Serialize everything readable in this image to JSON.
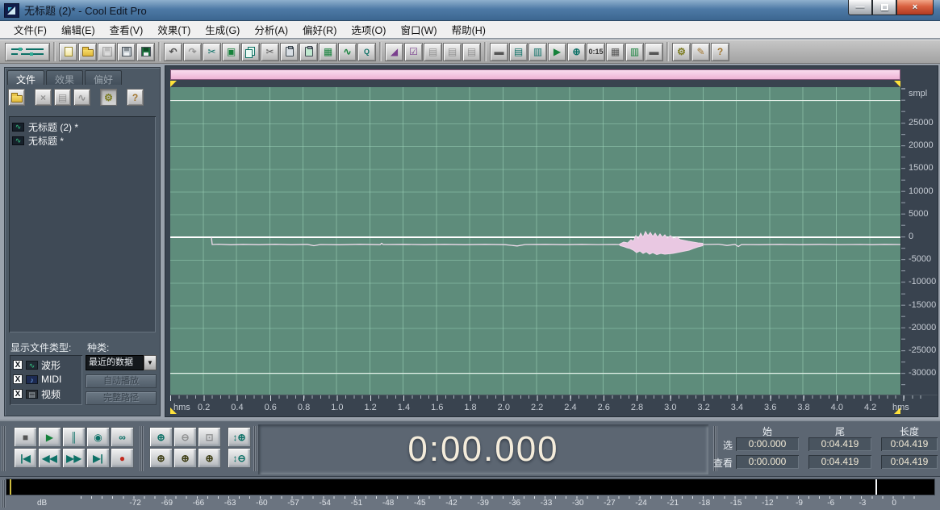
{
  "window": {
    "title": "无标题 (2)* - Cool Edit Pro"
  },
  "titlebar": {
    "minimize": "—",
    "close": "×"
  },
  "menu": {
    "items": [
      "文件(F)",
      "编辑(E)",
      "查看(V)",
      "效果(T)",
      "生成(G)",
      "分析(A)",
      "偏好(R)",
      "选项(O)",
      "窗口(W)",
      "帮助(H)"
    ]
  },
  "toolbar": {
    "groups": {
      "file": [
        {
          "name": "new-file-icon",
          "glyph": "",
          "cls": "page"
        },
        {
          "name": "open-file-icon",
          "glyph": "",
          "cls": "folder"
        },
        {
          "name": "save-file-icon",
          "glyph": "",
          "cls": "disk disabled"
        },
        {
          "name": "save-as-icon",
          "glyph": "",
          "cls": "disk"
        },
        {
          "name": "save-copy-icon",
          "glyph": "",
          "cls": "diskg"
        }
      ],
      "edit": [
        {
          "name": "undo-icon",
          "glyph": "↶",
          "cls": "gray bold"
        },
        {
          "name": "redo-icon",
          "glyph": "↷",
          "cls": "disabled bold"
        },
        {
          "name": "cut-tool-icon",
          "glyph": "✂",
          "cls": "teal"
        },
        {
          "name": "trim-icon",
          "glyph": "▣",
          "cls": "green"
        },
        {
          "name": "copy-icon",
          "glyph": "",
          "cls": "copyic"
        },
        {
          "name": "cut-icon",
          "glyph": "✂",
          "cls": "gray"
        },
        {
          "name": "paste-icon",
          "glyph": "",
          "cls": "clipic"
        },
        {
          "name": "paste-new-icon",
          "glyph": "",
          "cls": "clipic greenclip"
        },
        {
          "name": "convert-sample-type-icon",
          "glyph": "▦",
          "cls": "green"
        },
        {
          "name": "insert-multitrack-icon",
          "glyph": "∿",
          "cls": "green bold"
        },
        {
          "name": "scrub-icon",
          "glyph": "Q",
          "cls": "teal smalltext"
        }
      ],
      "view": [
        {
          "name": "envelope-tool-icon",
          "glyph": "◢",
          "cls": "purple"
        },
        {
          "name": "settings-dialog-icon",
          "glyph": "☑",
          "cls": "purple"
        },
        {
          "name": "cue-range-1-icon",
          "glyph": "▤",
          "cls": "disabled"
        },
        {
          "name": "cue-range-2-icon",
          "glyph": "▤",
          "cls": "disabled"
        },
        {
          "name": "cue-range-3-icon",
          "glyph": "▤",
          "cls": "disabled"
        }
      ],
      "windows": [
        {
          "name": "window-icon",
          "glyph": "▬",
          "cls": "gray"
        },
        {
          "name": "file-info-window-icon",
          "glyph": "▤",
          "cls": "teal"
        },
        {
          "name": "cue-list-window-icon",
          "glyph": "▥",
          "cls": "teal"
        },
        {
          "name": "play-list-window-icon",
          "glyph": "▶",
          "cls": "green"
        },
        {
          "name": "zoom-window-icon",
          "glyph": "⊕",
          "cls": "teal bold"
        },
        {
          "name": "time-window-icon",
          "glyph": "0:15",
          "cls": "smalltext"
        },
        {
          "name": "cue-sheet-icon",
          "glyph": "▦",
          "cls": "gray"
        },
        {
          "name": "organizer-window-icon",
          "glyph": "▥",
          "cls": "green"
        },
        {
          "name": "level-meter-window-icon",
          "glyph": "▬",
          "cls": "gray"
        }
      ],
      "help": [
        {
          "name": "settings-icon",
          "glyph": "⚙",
          "cls": "olive bold"
        },
        {
          "name": "scripts-icon",
          "glyph": "✎",
          "cls": "tan"
        },
        {
          "name": "help-icon",
          "glyph": "?",
          "cls": "tan bold"
        }
      ]
    }
  },
  "file_panel": {
    "tabs": [
      "文件",
      "效果",
      "偏好"
    ],
    "tools": [
      {
        "name": "open-file-icon",
        "glyph": "",
        "cls": "folder"
      },
      {
        "name": "close-file-icon",
        "glyph": "×",
        "cls": "disabled bold gapL"
      },
      {
        "name": "import-file-icon",
        "glyph": "▤",
        "cls": "disabled"
      },
      {
        "name": "insert-to-multitrack-icon",
        "glyph": "∿",
        "cls": "disabled bold"
      },
      {
        "name": "options-icon",
        "glyph": "⚙",
        "cls": "olive bold pressed gapL"
      },
      {
        "name": "help-icon",
        "glyph": "?",
        "cls": "tan bold gapL"
      }
    ],
    "files": [
      {
        "label": "无标题 (2) *",
        "icon": "∿"
      },
      {
        "label": "无标题 *",
        "icon": "∿"
      }
    ],
    "show_types_label": "显示文件类型:",
    "types": [
      {
        "check": "X",
        "label": "波形",
        "icon": "∿",
        "cls": "wave"
      },
      {
        "check": "X",
        "label": "MIDI",
        "icon": "♪",
        "cls": "midi"
      },
      {
        "check": "X",
        "label": "视频",
        "icon": "▤",
        "cls": "video"
      }
    ],
    "kind_label": "种类:",
    "kind_value": "最近的数据",
    "kind_arrow": "▼",
    "autoplay_label": "自动播放",
    "fullpath_label": "完整路径"
  },
  "wave": {
    "unit": "smpl",
    "y_ticks": [
      "25000",
      "20000",
      "15000",
      "10000",
      "5000",
      "0",
      "-5000",
      "-10000",
      "-15000",
      "-20000",
      "-25000",
      "-30000"
    ],
    "timeline": {
      "unit": "hms",
      "ticks": [
        "0.2",
        "0.4",
        "0.6",
        "0.8",
        "1.0",
        "1.2",
        "1.4",
        "1.6",
        "1.8",
        "2.0",
        "2.2",
        "2.4",
        "2.6",
        "2.8",
        "3.0",
        "3.2",
        "3.4",
        "3.6",
        "3.8",
        "4.0",
        "4.2"
      ]
    }
  },
  "transport": {
    "row1": [
      {
        "name": "stop-button",
        "glyph": "■",
        "cls": "gray"
      },
      {
        "name": "play-button",
        "glyph": "▶",
        "cls": "green"
      },
      {
        "name": "pause-button",
        "glyph": "║",
        "cls": "teal bold"
      },
      {
        "name": "play-looped-button",
        "glyph": "◉",
        "cls": "teal"
      },
      {
        "name": "loop-button",
        "glyph": "∞",
        "cls": "teal bold"
      }
    ],
    "row2": [
      {
        "name": "go-to-start-button",
        "glyph": "|◀",
        "cls": "teal smalltext"
      },
      {
        "name": "rewind-button",
        "glyph": "◀◀",
        "cls": "teal smalltext"
      },
      {
        "name": "fast-forward-button",
        "glyph": "▶▶",
        "cls": "teal smalltext"
      },
      {
        "name": "go-to-end-button",
        "glyph": "▶|",
        "cls": "teal smalltext"
      },
      {
        "name": "record-button",
        "glyph": "●",
        "cls": "red"
      }
    ]
  },
  "zoomc": {
    "row1": [
      {
        "name": "zoom-in-button",
        "glyph": "⊕",
        "cls": "teal bold"
      },
      {
        "name": "zoom-out-button",
        "glyph": "⊖",
        "cls": "disabled bold"
      },
      {
        "name": "zoom-full-button",
        "glyph": "⊡",
        "cls": "disabled bold"
      }
    ],
    "row2": [
      {
        "name": "zoom-selection-button",
        "glyph": "⊕",
        "cls": "yellowbtn"
      },
      {
        "name": "zoom-selection-left-button",
        "glyph": "⊕",
        "cls": "yellowbtn"
      },
      {
        "name": "zoom-selection-right-button",
        "glyph": "⊕",
        "cls": "yellowbtn"
      }
    ],
    "vertical": [
      {
        "name": "vertical-zoom-in-button",
        "glyph": "↕⊕",
        "cls": "teal smalltext"
      },
      {
        "name": "vertical-zoom-out-button",
        "glyph": "↕⊖",
        "cls": "teal smalltext"
      }
    ]
  },
  "clock": {
    "value": "0:00.000"
  },
  "selection": {
    "headers": [
      "始",
      "尾",
      "长度"
    ],
    "rows": [
      {
        "label": "选",
        "start": "0:00.000",
        "end": "0:04.419",
        "length": "0:04.419"
      },
      {
        "label": "查看",
        "start": "0:00.000",
        "end": "0:04.419",
        "length": "0:04.419"
      }
    ]
  },
  "meter": {
    "unit": "dB",
    "labels": [
      "-72",
      "-69",
      "-66",
      "-63",
      "-60",
      "-57",
      "-54",
      "-51",
      "-48",
      "-45",
      "-42",
      "-39",
      "-36",
      "-33",
      "-30",
      "-27",
      "-24",
      "-21",
      "-18",
      "-15",
      "-12",
      "-9",
      "-6",
      "-3",
      "0"
    ]
  }
}
